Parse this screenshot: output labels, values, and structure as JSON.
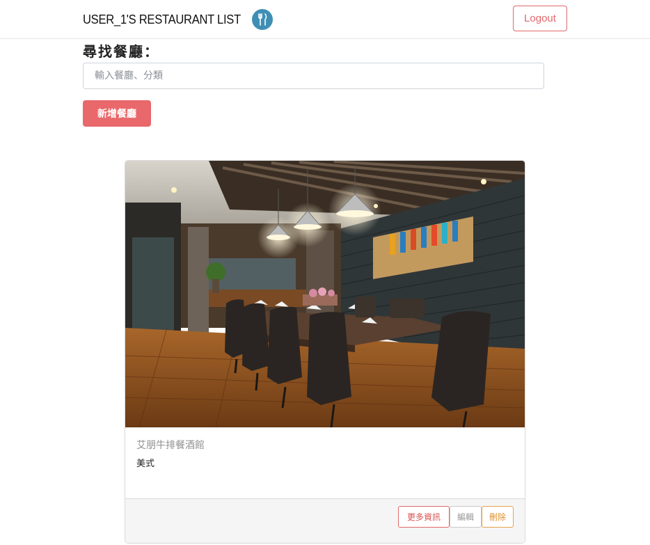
{
  "navbar": {
    "brand": "USER_1'S RESTAURANT LIST",
    "brand_icon": "fork-knife-icon",
    "logout_label": "Logout"
  },
  "search": {
    "title": "尋找餐廳：",
    "placeholder": "輸入餐廳、分類",
    "value": ""
  },
  "add_button_label": "新增餐廳",
  "colors": {
    "accent": "#e8686b",
    "logo_bg": "#3f8fb5",
    "delete": "#e0902c"
  },
  "restaurants": [
    {
      "name": "艾朋牛排餐酒館",
      "category": "美式",
      "image": "restaurant-photo",
      "actions": {
        "detail": "更多資訊",
        "edit": "編輯",
        "delete": "刪除"
      }
    }
  ]
}
